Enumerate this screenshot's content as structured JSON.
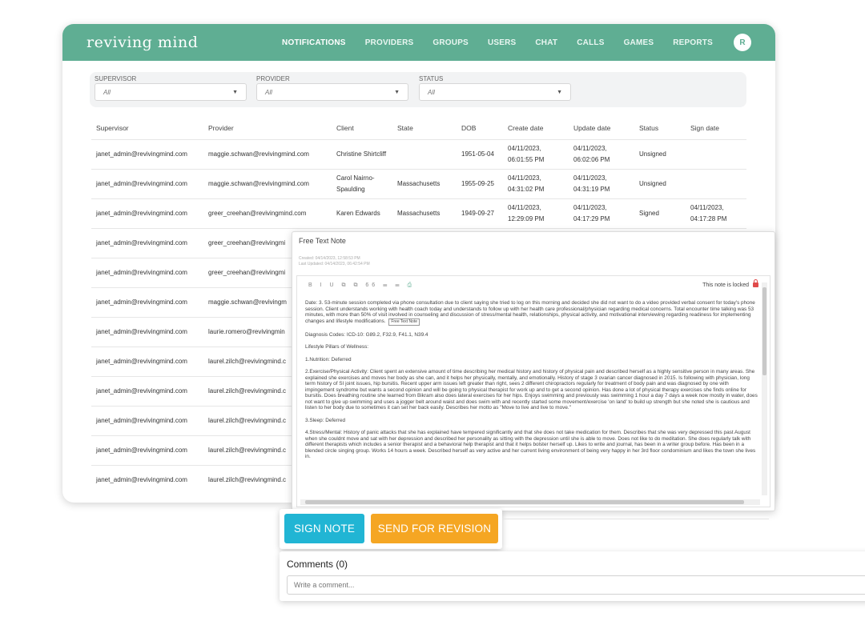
{
  "app": {
    "logo": "reviving mind",
    "avatar_initial": "R"
  },
  "nav": [
    "NOTIFICATIONS",
    "PROVIDERS",
    "GROUPS",
    "USERS",
    "CHAT",
    "CALLS",
    "GAMES",
    "REPORTS"
  ],
  "filters": {
    "supervisor": {
      "label": "SUPERVISOR",
      "value": "All"
    },
    "provider": {
      "label": "PROVIDER",
      "value": "All"
    },
    "status": {
      "label": "STATUS",
      "value": "All"
    }
  },
  "table": {
    "headers": [
      "Supervisor",
      "Provider",
      "Client",
      "State",
      "DOB",
      "Create date",
      "Update date",
      "Status",
      "Sign date"
    ],
    "rows": [
      {
        "supervisor": "janet_admin@revivingmind.com",
        "provider": "maggie.schwan@revivingmind.com",
        "client": "Christine Shirtcliff",
        "state": "",
        "dob": "1951-05-04",
        "create": "04/11/2023, 06:01:55 PM",
        "update": "04/11/2023, 06:02:06 PM",
        "status": "Unsigned",
        "sign": ""
      },
      {
        "supervisor": "janet_admin@revivingmind.com",
        "provider": "maggie.schwan@revivingmind.com",
        "client": "Carol Nairno-Spaulding",
        "state": "Massachusetts",
        "dob": "1955-09-25",
        "create": "04/11/2023, 04:31:02 PM",
        "update": "04/11/2023, 04:31:19 PM",
        "status": "Unsigned",
        "sign": ""
      },
      {
        "supervisor": "janet_admin@revivingmind.com",
        "provider": "greer_creehan@revivingmind.com",
        "client": "Karen Edwards",
        "state": "Massachusetts",
        "dob": "1949-09-27",
        "create": "04/11/2023, 12:29:09 PM",
        "update": "04/11/2023, 04:17:29 PM",
        "status": "Signed",
        "sign": "04/11/2023, 04:17:28 PM"
      },
      {
        "supervisor": "janet_admin@revivingmind.com",
        "provider": "greer_creehan@revivingmi",
        "client": "",
        "state": "",
        "dob": "",
        "create": "",
        "update": "",
        "status": "",
        "sign": ""
      },
      {
        "supervisor": "janet_admin@revivingmind.com",
        "provider": "greer_creehan@revivingmi",
        "client": "",
        "state": "",
        "dob": "",
        "create": "",
        "update": "",
        "status": "",
        "sign": ""
      },
      {
        "supervisor": "janet_admin@revivingmind.com",
        "provider": "maggie.schwan@revivingm",
        "client": "",
        "state": "",
        "dob": "",
        "create": "",
        "update": "",
        "status": "",
        "sign": ""
      },
      {
        "supervisor": "janet_admin@revivingmind.com",
        "provider": "laurie.romero@revivingmin",
        "client": "",
        "state": "",
        "dob": "",
        "create": "",
        "update": "",
        "status": "",
        "sign": ""
      },
      {
        "supervisor": "janet_admin@revivingmind.com",
        "provider": "laurel.zilch@revivingmind.c",
        "client": "",
        "state": "",
        "dob": "",
        "create": "",
        "update": "",
        "status": "",
        "sign": ""
      },
      {
        "supervisor": "janet_admin@revivingmind.com",
        "provider": "laurel.zilch@revivingmind.c",
        "client": "",
        "state": "",
        "dob": "",
        "create": "",
        "update": "",
        "status": "",
        "sign": ""
      },
      {
        "supervisor": "janet_admin@revivingmind.com",
        "provider": "laurel.zilch@revivingmind.c",
        "client": "",
        "state": "",
        "dob": "",
        "create": "",
        "update": "",
        "status": "",
        "sign": ""
      },
      {
        "supervisor": "janet_admin@revivingmind.com",
        "provider": "laurel.zilch@revivingmind.c",
        "client": "",
        "state": "",
        "dob": "",
        "create": "",
        "update": "",
        "status": "",
        "sign": ""
      },
      {
        "supervisor": "janet_admin@revivingmind.com",
        "provider": "laurel.zilch@revivingmind.c",
        "client": "",
        "state": "",
        "dob": "",
        "create": "",
        "update": "",
        "status": "",
        "sign": ""
      }
    ]
  },
  "note": {
    "title": "Free Text Note",
    "created": "Created: 04/14/2023, 12:58:53 PM",
    "updated": "Last Updated: 04/14/2023, 06:42:54 PM",
    "toolbar": "B I U ⧉ ⧉ 66 ☰ ☰",
    "locked_text": "This note is locked",
    "tooltip": "Free Text Note",
    "paragraphs": [
      "Date: 3. 53-minute session completed via phone consultation due to client saying she tried to log on this morning and decided she did not want to do a video provided verbal consent for today's phone session. Client understands working with health coach today and understands to follow up with her health care professional/physician regarding medical concerns. Total encounter time talking was 53 minutes, with more than 50% of visit involved in counseling and discussion of stress/mental health, relationships, physical activity, and motivational interviewing regarding readiness for implementing changes and lifestyle modifications.",
      "Diagnosis Codes: ICD-10: G89.2, F32.9, F41.1, N39.4",
      "Lifestyle Pillars of Wellness:",
      "1.Nutrition: Deferred",
      "2.Exercise/Physical Activity: Client spent an extensive amount of time describing her medical history and history of physical pain and described herself as a highly sensitive person in many areas. She explained she exercises and moves her body as she can, and it helps her physically, mentally, and emotionally. History of stage 3 ovarian cancer diagnosed in 2015. Is following with physician, long term history of SI joint issues, hip bursitis. Recent upper arm issues left greater than right, sees 2 different chiropractors regularly for treatment of body pain and was diagnosed by one with impingement syndrome but wants a second opinion and will be going to physical therapist for work up and to get a second opinion. Has done a lot of physical therapy exercises she finds online for bursitis. Does breathing routine she learned from Bikram also does lateral exercises for her hips. Enjoys swimming and previously was swimming 1 hour a day 7 days a week now mostly in water, does not want to give up swimming and uses a jogger belt around waist and does swim with and recently started some movement/exercise 'on land' to build up strength but she noted she is cautious and listen to her body due to sometimes it can set her back easily. Describes her motto as \"Move to live and live to move.\"",
      "3.Sleep: Deferred",
      "4.Stress/Mental: History of panic attacks that she has explained have tempered significantly and that she does not take medication for them. Describes that she was very depressed this past August when she couldnt move and sat with her depression and described her personality as sitting with the depression until she is able to move. Does not like to do meditation. She does regularly talk with different therapists which includes a senior therapist and a behavioral help therapist and that it helps bolster herself up. Likes to write and journal, has been in a writer group before. Has been in a blended circle singing group. Works 14 hours a week. Described herself as very active and her current living environment of being very happy in her 3rd floor condominium and likes the town she lives in."
    ]
  },
  "actions": {
    "sign": "SIGN NOTE",
    "send": "SEND FOR REVISION"
  },
  "comments": {
    "title": "Comments (0)",
    "placeholder": "Write a comment..."
  },
  "colors": {
    "brand": "#5fae93",
    "sign_button": "#21b5d4",
    "send_button": "#f5a623",
    "unsigned": "#e06a6a",
    "lock": "#e04a4a"
  }
}
